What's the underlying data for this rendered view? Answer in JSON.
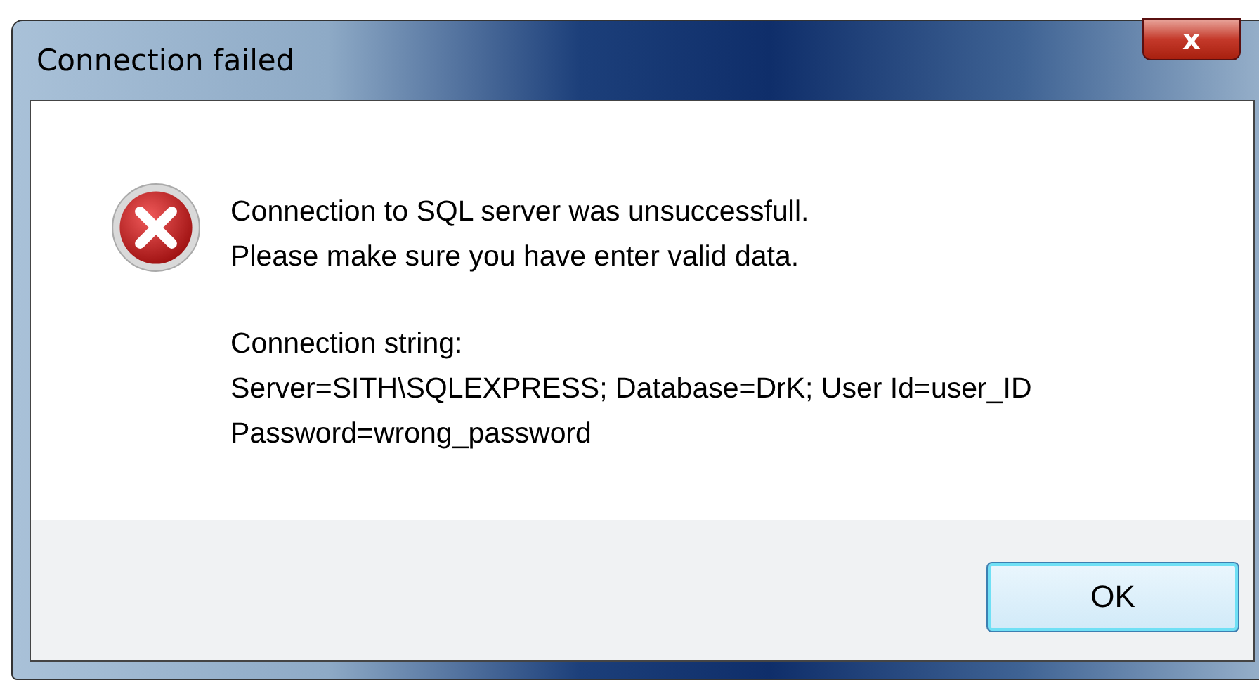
{
  "window": {
    "title": "Connection failed",
    "close_label": "x"
  },
  "message": {
    "lines": [
      "Connection to SQL server was unsuccessfull.",
      "Please make sure you have enter valid data."
    ]
  },
  "details": {
    "lines": [
      "Connection string:",
      "Server=SITH\\SQLEXPRESS; Database=DrK; User Id=user_ID",
      "Password=wrong_password"
    ]
  },
  "buttons": [
    {
      "label": "OK",
      "focused": true
    }
  ]
}
